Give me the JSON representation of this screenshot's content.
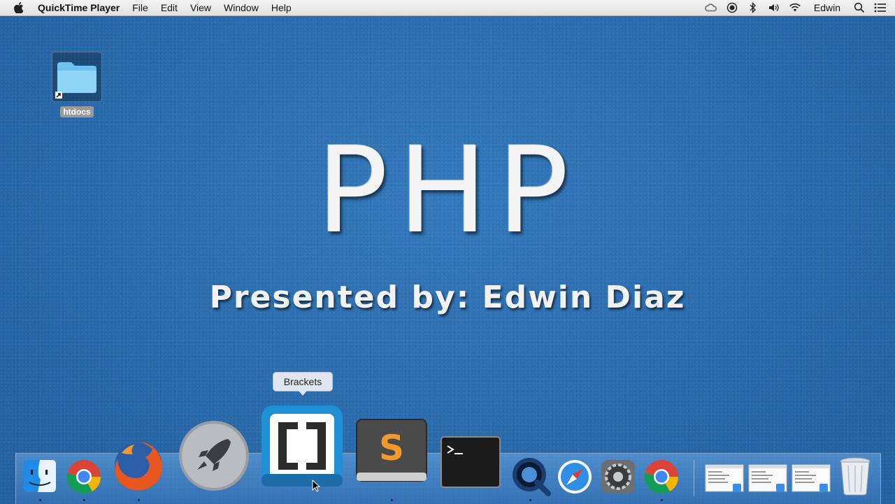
{
  "menubar": {
    "app_name": "QuickTime Player",
    "items": [
      "File",
      "Edit",
      "View",
      "Window",
      "Help"
    ],
    "user": "Edwin"
  },
  "desktop": {
    "icon_label": "htdocs"
  },
  "slide": {
    "title": "PHP",
    "subtitle": "Presented by: Edwin Diaz"
  },
  "dock": {
    "tooltip": "Brackets",
    "apps": [
      "Finder",
      "Chrome",
      "Firefox",
      "Launchpad",
      "Brackets",
      "Sublime Text",
      "Terminal",
      "QuickTime Player",
      "Safari",
      "System Preferences",
      "Chrome",
      "Window 1",
      "Window 2",
      "Window 3",
      "Trash"
    ]
  }
}
